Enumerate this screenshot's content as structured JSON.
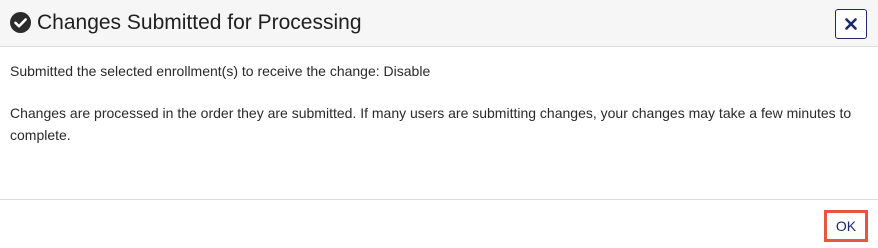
{
  "dialog": {
    "title": "Changes Submitted for Processing",
    "icons": {
      "title_icon": "check-circle-icon",
      "close_icon": "close-icon"
    },
    "body": {
      "line1": "Submitted the selected enrollment(s) to receive the change: Disable",
      "line2": "Changes are processed in the order they are submitted. If many users are submitting changes, your changes may take a few minutes to complete."
    },
    "footer": {
      "ok_label": "OK"
    },
    "colors": {
      "header_bg": "#f6f6f6",
      "accent": "#1c2a6b",
      "highlight": "#e8563f",
      "divider": "#dcdcdc"
    }
  }
}
